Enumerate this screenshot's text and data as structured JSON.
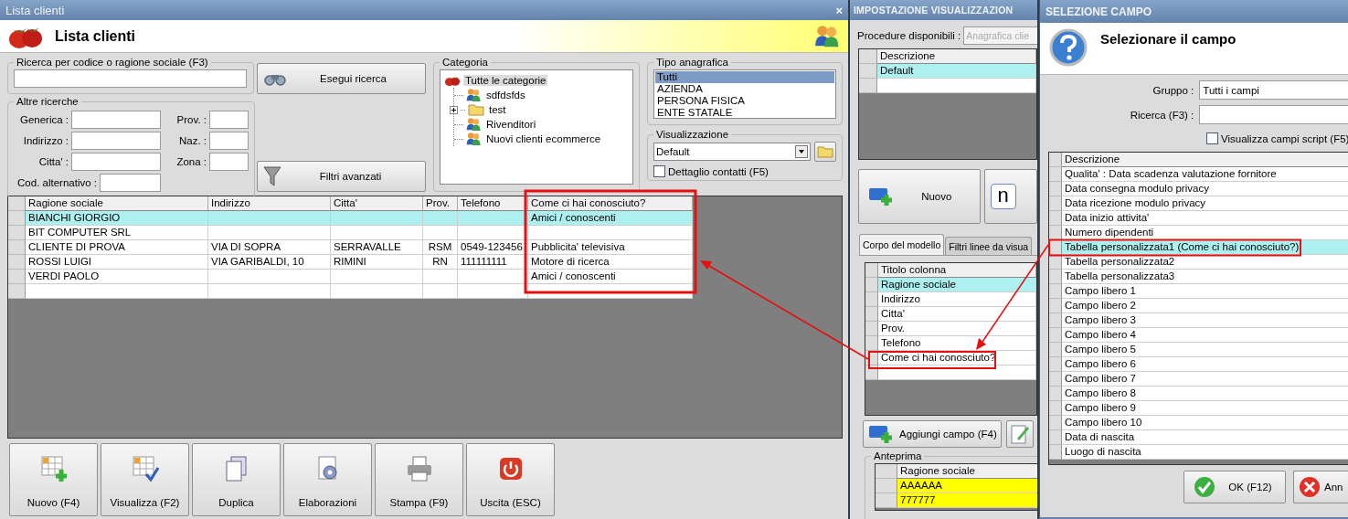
{
  "main_window": {
    "title": "Lista clienti",
    "close_glyph": "×",
    "heading": "Lista clienti",
    "code_search": {
      "legend": "Ricerca per codice o ragione sociale (F3)"
    },
    "search_button": {
      "label": "Esegui ricerca"
    },
    "other_searches": {
      "legend": "Altre ricerche",
      "fields": [
        {
          "label": "Generica :"
        },
        {
          "label": "Prov. :"
        },
        {
          "label": "Indirizzo :"
        },
        {
          "label": "Naz. :"
        },
        {
          "label": "Citta' :"
        },
        {
          "label": "Zona :"
        },
        {
          "label": "Cod. alternativo :"
        }
      ]
    },
    "advanced_filters_button": {
      "label": "Filtri avanzati"
    },
    "category": {
      "legend": "Categoria",
      "tree": [
        {
          "label": "Tutte le categorie",
          "kind": "root",
          "selected": true,
          "children": [
            {
              "label": "sdfdsfds",
              "kind": "group",
              "selected": false
            },
            {
              "label": "test",
              "kind": "folder",
              "selected": false,
              "expanded": false
            },
            {
              "label": "Rivenditori",
              "kind": "group",
              "selected": false
            },
            {
              "label": "Nuovi clienti ecommerce",
              "kind": "group",
              "selected": false
            }
          ]
        }
      ]
    },
    "record_type": {
      "legend": "Tipo anagrafica",
      "items": [
        {
          "label": "Tutti",
          "selected": true
        },
        {
          "label": "AZIENDA",
          "selected": false
        },
        {
          "label": "PERSONA FISICA",
          "selected": false
        },
        {
          "label": "ENTE STATALE",
          "selected": false
        }
      ]
    },
    "view": {
      "legend": "Visualizzazione",
      "value": "Default",
      "contact_detail": {
        "label": "Dettaglio contatti (F5)",
        "checked": false
      }
    },
    "table": {
      "columns": [
        "Ragione sociale",
        "Indirizzo",
        "Citta'",
        "Prov.",
        "Telefono",
        "Come ci hai conosciuto?"
      ],
      "rows": [
        {
          "cells": [
            "BIANCHI GIORGIO",
            null,
            null,
            null,
            null,
            "Amici / conoscenti"
          ],
          "selected": true
        },
        {
          "cells": [
            "BIT COMPUTER SRL",
            null,
            null,
            null,
            null,
            null
          ],
          "selected": false
        },
        {
          "cells": [
            "CLIENTE DI PROVA",
            "VIA DI SOPRA",
            "SERRAVALLE",
            "RSM",
            "0549-123456",
            "Pubblicita' televisiva"
          ],
          "selected": false
        },
        {
          "cells": [
            "ROSSI LUIGI",
            "VIA GARIBALDI, 10",
            "RIMINI",
            "RN",
            "111111111",
            "Motore di ricerca"
          ],
          "selected": false
        },
        {
          "cells": [
            "VERDI PAOLO",
            null,
            null,
            null,
            null,
            "Amici / conoscenti"
          ],
          "selected": false
        }
      ]
    },
    "buttons": [
      {
        "label": "Nuovo (F4)",
        "kind": "new"
      },
      {
        "label": "Visualizza (F2)",
        "kind": "view"
      },
      {
        "label": "Duplica",
        "kind": "duplicate"
      },
      {
        "label": "Elaborazioni",
        "kind": "process"
      },
      {
        "label": "Stampa (F9)",
        "kind": "print"
      },
      {
        "label": "Uscita (ESC)",
        "kind": "exit"
      }
    ]
  },
  "settings_window": {
    "title": "IMPOSTAZIONE VISUALIZZAZION",
    "procedures": {
      "label": "Procedure disponibili :",
      "value": "Anagrafica clie",
      "disabled": true
    },
    "models": {
      "columns": [
        "Descrizione"
      ],
      "rows": [
        {
          "cells": [
            "Default"
          ],
          "selected": true
        }
      ]
    },
    "new_button": {
      "label": "Nuovo"
    },
    "n_button": {
      "label": "n"
    },
    "tabs": [
      {
        "label": "Corpo del modello",
        "selected": true
      },
      {
        "label": "Filtri linee da visua",
        "selected": false
      }
    ],
    "columns_table": {
      "columns": [
        "Titolo colonna"
      ],
      "rows": [
        {
          "cells": [
            "Ragione sociale"
          ],
          "selected": true
        },
        {
          "cells": [
            "Indirizzo"
          ],
          "selected": false
        },
        {
          "cells": [
            "Citta'"
          ],
          "selected": false
        },
        {
          "cells": [
            "Prov."
          ],
          "selected": false
        },
        {
          "cells": [
            "Telefono"
          ],
          "selected": false
        },
        {
          "cells": [
            "Come ci hai conosciuto?"
          ],
          "selected": false
        }
      ]
    },
    "add_field_button": {
      "label": "Aggiungi campo (F4)"
    },
    "preview": {
      "legend": "Anteprima",
      "columns": [
        "Ragione sociale"
      ],
      "rows": [
        {
          "cells": [
            "AAAAAA"
          ]
        },
        {
          "cells": [
            "777777"
          ]
        }
      ]
    }
  },
  "field_dialog": {
    "title": "SELEZIONE CAMPO",
    "heading": "Selezionare il campo",
    "group": {
      "label": "Gruppo :",
      "value": "Tutti i campi"
    },
    "search": {
      "label": "Ricerca (F3) :"
    },
    "script_fields": {
      "label": "Visualizza campi script (F5)",
      "checked": false
    },
    "fields_table": {
      "columns": [
        "Descrizione"
      ],
      "rows": [
        {
          "cells": [
            "Qualita' : Data scadenza valutazione fornitore"
          ],
          "selected": false
        },
        {
          "cells": [
            "Data consegna modulo privacy"
          ],
          "selected": false
        },
        {
          "cells": [
            "Data ricezione modulo privacy"
          ],
          "selected": false
        },
        {
          "cells": [
            "Data inizio attivita'"
          ],
          "selected": false
        },
        {
          "cells": [
            "Numero dipendenti"
          ],
          "selected": false
        },
        {
          "cells": [
            "Tabella personalizzata1 (Come ci hai conosciuto?)"
          ],
          "selected": true
        },
        {
          "cells": [
            "Tabella personalizzata2"
          ],
          "selected": false
        },
        {
          "cells": [
            "Tabella personalizzata3"
          ],
          "selected": false
        },
        {
          "cells": [
            "Campo libero 1"
          ],
          "selected": false
        },
        {
          "cells": [
            "Campo libero 2"
          ],
          "selected": false
        },
        {
          "cells": [
            "Campo libero 3"
          ],
          "selected": false
        },
        {
          "cells": [
            "Campo libero 4"
          ],
          "selected": false
        },
        {
          "cells": [
            "Campo libero 5"
          ],
          "selected": false
        },
        {
          "cells": [
            "Campo libero 6"
          ],
          "selected": false
        },
        {
          "cells": [
            "Campo libero 7"
          ],
          "selected": false
        },
        {
          "cells": [
            "Campo libero 8"
          ],
          "selected": false
        },
        {
          "cells": [
            "Campo libero 9"
          ],
          "selected": false
        },
        {
          "cells": [
            "Campo libero 10"
          ],
          "selected": false
        },
        {
          "cells": [
            "Data di nascita"
          ],
          "selected": false
        },
        {
          "cells": [
            "Luogo di nascita"
          ],
          "selected": false
        }
      ]
    },
    "buttons": [
      {
        "label": "OK (F12)",
        "kind": "ok"
      },
      {
        "label": "Ann",
        "kind": "cancel"
      }
    ]
  }
}
